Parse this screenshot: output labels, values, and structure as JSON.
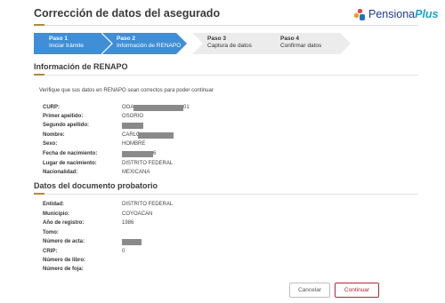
{
  "header": {
    "title": "Corrección de datos del asegurado",
    "logo_word1": "Pensiona",
    "logo_word2": "Plus"
  },
  "colors": {
    "step_active": "#3f8ed6",
    "step_inactive": "#ececec",
    "accent": "#b08a3a",
    "continue_border": "#b3263a"
  },
  "steps": [
    {
      "num": "Paso 1",
      "label": "Iniciar trámite",
      "state": "active"
    },
    {
      "num": "Paso 2",
      "label": "Información de RENAPO",
      "state": "active"
    },
    {
      "num": "Paso 3",
      "label": "Captura de datos",
      "state": "inactive"
    },
    {
      "num": "Paso 4",
      "label": "Confirmar datos",
      "state": "inactive"
    }
  ],
  "renapo": {
    "title": "Información de RENAPO",
    "intro": "Verifique que sus datos en RENAPO sean correctos para poder continuar",
    "fields": [
      {
        "label": "CURP:",
        "value": "OOA",
        "suffix": "01"
      },
      {
        "label": "Primer apellido:",
        "value": "OSORIO"
      },
      {
        "label": "Segundo apellido:",
        "value": ""
      },
      {
        "label": "Nombre:",
        "value": "CARLO"
      },
      {
        "label": "Sexo:",
        "value": "HOMBRE"
      },
      {
        "label": "Fecha de nacimiento:",
        "value": "",
        "suffix": "6"
      },
      {
        "label": "Lugar de nacimiento:",
        "value": "DISTRITO FEDERAL"
      },
      {
        "label": "Nacionalidad:",
        "value": "MEXICANA"
      }
    ]
  },
  "documento": {
    "title": "Datos del documento probatorio",
    "fields": [
      {
        "label": "Entidad:",
        "value": "DISTRITO FEDERAL"
      },
      {
        "label": "Municipio:",
        "value": "COYOACAN"
      },
      {
        "label": "Año de registro:",
        "value": "1986"
      },
      {
        "label": "Tomo:",
        "value": ""
      },
      {
        "label": "Número de acta:",
        "value": ""
      },
      {
        "label": "CRIP:",
        "value": "0"
      },
      {
        "label": "Número de libro:",
        "value": ""
      },
      {
        "label": "Número de foja:",
        "value": ""
      }
    ]
  },
  "actions": {
    "cancel": "Cancelar",
    "continue": "Continuar"
  }
}
